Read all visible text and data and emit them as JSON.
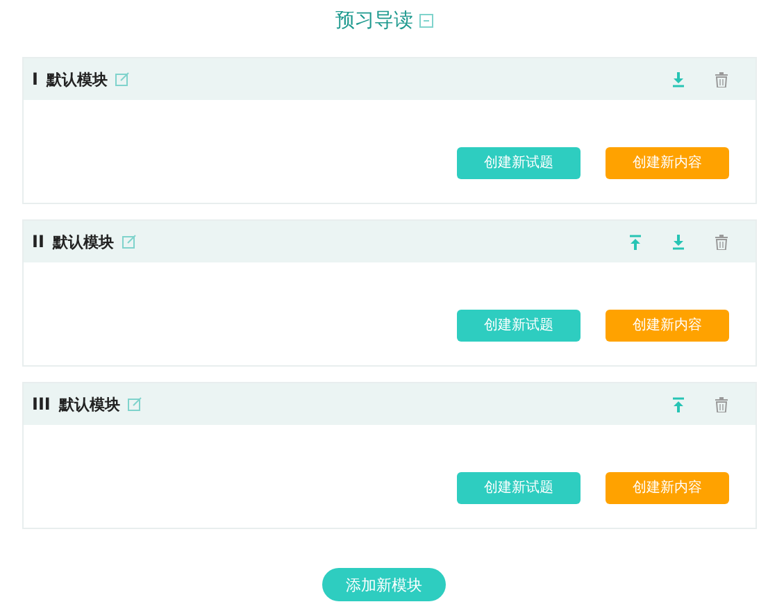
{
  "title": "预习导读",
  "modules": [
    {
      "number": "I",
      "name": "默认模块",
      "can_move_up": false,
      "can_move_down": true,
      "buttons": [
        {
          "label": "创建新试题",
          "kind": "primary"
        },
        {
          "label": "创建新内容",
          "kind": "warning"
        }
      ]
    },
    {
      "number": "II",
      "name": "默认模块",
      "can_move_up": true,
      "can_move_down": true,
      "buttons": [
        {
          "label": "创建新试题",
          "kind": "primary"
        },
        {
          "label": "创建新内容",
          "kind": "warning"
        }
      ]
    },
    {
      "number": "III",
      "name": "默认模块",
      "can_move_up": true,
      "can_move_down": false,
      "buttons": [
        {
          "label": "创建新试题",
          "kind": "primary"
        },
        {
          "label": "创建新内容",
          "kind": "warning"
        }
      ]
    }
  ],
  "add_button": "添加新模块"
}
